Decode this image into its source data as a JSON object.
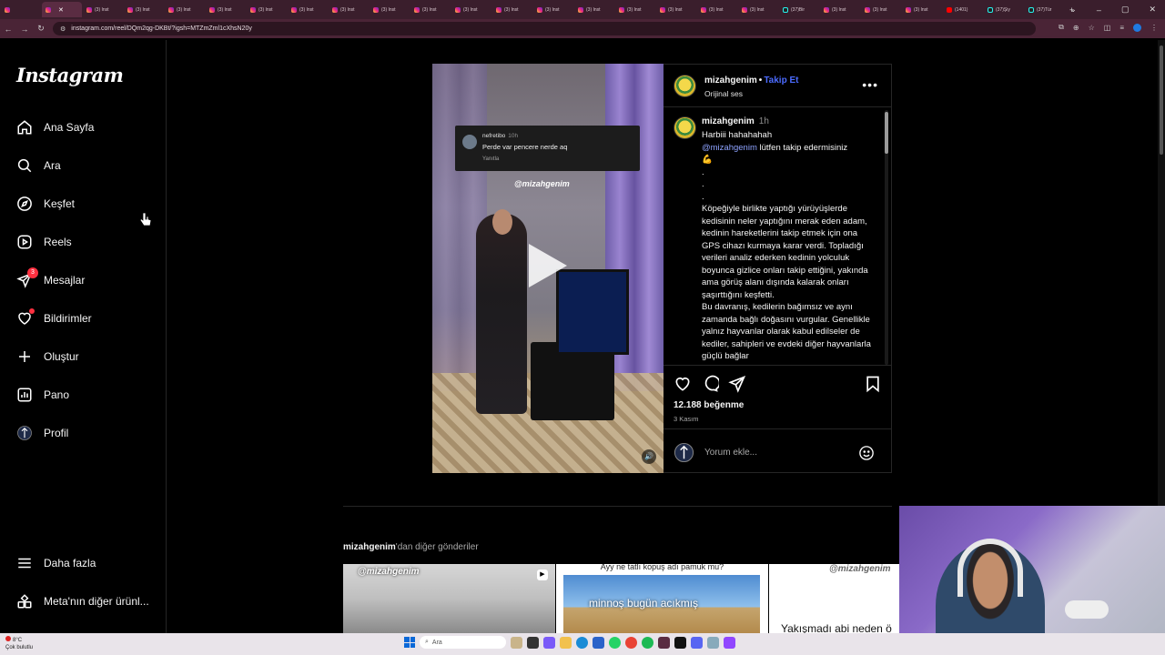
{
  "browser": {
    "tabs": [
      {
        "label": "",
        "kind": "ig",
        "active": false
      },
      {
        "label": "",
        "kind": "ig",
        "active": true
      },
      {
        "label": "(3) Inst",
        "kind": "ig"
      },
      {
        "label": "(3) Inst",
        "kind": "ig"
      },
      {
        "label": "(3) Inst",
        "kind": "ig"
      },
      {
        "label": "(3) Inst",
        "kind": "ig"
      },
      {
        "label": "(3) Inst",
        "kind": "ig"
      },
      {
        "label": "(3) Inst",
        "kind": "ig"
      },
      {
        "label": "(3) Inst",
        "kind": "ig"
      },
      {
        "label": "(3) Inst",
        "kind": "ig"
      },
      {
        "label": "(3) Inst",
        "kind": "ig"
      },
      {
        "label": "(3) Inst",
        "kind": "ig"
      },
      {
        "label": "(3) Inst",
        "kind": "ig"
      },
      {
        "label": "(3) Inst",
        "kind": "ig"
      },
      {
        "label": "(3) Inst",
        "kind": "ig"
      },
      {
        "label": "(3) Inst",
        "kind": "ig"
      },
      {
        "label": "(3) Inst",
        "kind": "ig"
      },
      {
        "label": "(3) Inst",
        "kind": "ig"
      },
      {
        "label": "(3) Inst",
        "kind": "ig"
      },
      {
        "label": "(37)Bir",
        "kind": "tt"
      },
      {
        "label": "(3) Inst",
        "kind": "ig"
      },
      {
        "label": "(3) Inst",
        "kind": "ig"
      },
      {
        "label": "(3) Inst",
        "kind": "ig"
      },
      {
        "label": "(1401)",
        "kind": "yt"
      },
      {
        "label": "(37)Şiy",
        "kind": "tt"
      },
      {
        "label": "(37)Tür",
        "kind": "tt"
      }
    ],
    "new_tab": "+",
    "url": "instagram.com/reel/DQm2qg-DKBt/?igsh=MTZmZml1cXhsN20y"
  },
  "sidebar": {
    "logo": "Instagram",
    "items": [
      {
        "label": "Ana Sayfa",
        "icon": "home-icon"
      },
      {
        "label": "Ara",
        "icon": "search-icon"
      },
      {
        "label": "Keşfet",
        "icon": "compass-icon"
      },
      {
        "label": "Reels",
        "icon": "reels-icon"
      },
      {
        "label": "Mesajlar",
        "icon": "messenger-icon",
        "badge": "3"
      },
      {
        "label": "Bildirimler",
        "icon": "heart-icon"
      },
      {
        "label": "Oluştur",
        "icon": "plus-icon"
      },
      {
        "label": "Pano",
        "icon": "dashboard-icon"
      },
      {
        "label": "Profil",
        "icon": "profile-avatar"
      }
    ],
    "bottom": [
      {
        "label": "Daha fazla",
        "icon": "menu-icon"
      },
      {
        "label": "Meta'nın diğer ürünl...",
        "icon": "meta-apps-icon"
      }
    ]
  },
  "video": {
    "comment_user": "nefretibo",
    "comment_time": "10h",
    "comment_text": "Perde var pencere nerde aq",
    "comment_reply": "Yanıtla",
    "watermark": "@mizahgenim"
  },
  "post": {
    "username": "mizahgenim",
    "separator": "•",
    "follow": "Takip Et",
    "audio": "Orijinal ses",
    "caption_user": "mizahgenim",
    "caption_time": "1h",
    "caption_line1": "Harbiii hahahahah",
    "caption_mention": "@mizahgenim",
    "caption_line2": " lütfen takip edermisiniz",
    "caption_emoji": "💪",
    "caption_body": ".\n.\n.\nKöpeğiyle birlikte yaptığı yürüyüşlerde kedisinin neler yaptığını merak eden adam, kedinin hareketlerini takip etmek için ona GPS cihazı kurmaya karar verdi. Topladığı verileri analiz ederken kedinin yolculuk boyunca gizlice onları takip ettiğini, yakında ama görüş alanı dışında kalarak onları şaşırttığını keşfetti.\nBu davranış, kedilerin bağımsız ve aynı zamanda bağlı doğasını vurgular. Genellikle yalnız hayvanlar olarak kabul edilseler de kediler, sahipleri ve evdeki diğer hayvanlarla güçlü bağlar",
    "likes": "12.188 beğenme",
    "date": "3 Kasım",
    "comment_placeholder": "Yorum ekle..."
  },
  "more": {
    "user": "mizahgenim",
    "suffix": "'dan diğer gönderiler",
    "thumbs": [
      {
        "watermark": "@mizahgenim"
      },
      {
        "top": "Ayy ne tatlı kopuş adı pamuk mu?",
        "text": "minnoş bugün acıkmış"
      },
      {
        "watermark": "@mizahgenim",
        "text": "Yakışmadı abi neden ö"
      }
    ]
  },
  "taskbar": {
    "temp": "8°C",
    "weather": "Çok bulutlu",
    "search": "Ara"
  }
}
